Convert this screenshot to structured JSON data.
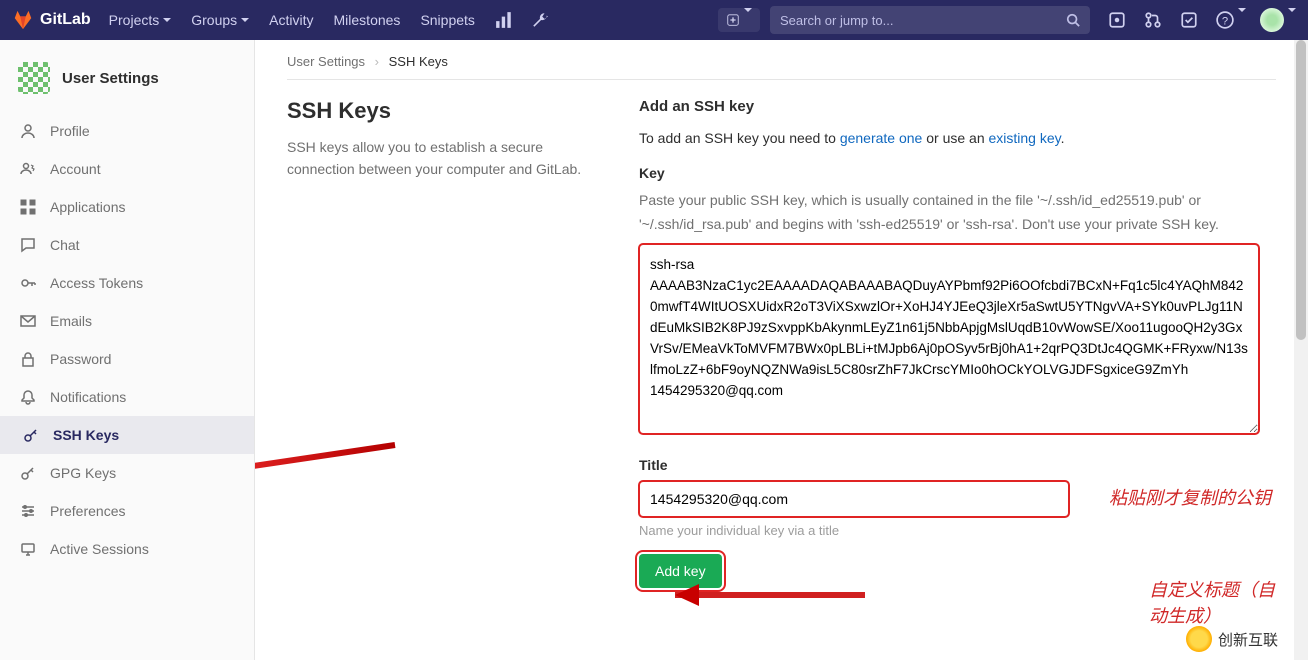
{
  "header": {
    "brand": "GitLab",
    "nav": {
      "projects": "Projects",
      "groups": "Groups",
      "activity": "Activity",
      "milestones": "Milestones",
      "snippets": "Snippets"
    },
    "search_placeholder": "Search or jump to..."
  },
  "sidebar": {
    "title": "User Settings",
    "items": [
      {
        "label": "Profile"
      },
      {
        "label": "Account"
      },
      {
        "label": "Applications"
      },
      {
        "label": "Chat"
      },
      {
        "label": "Access Tokens"
      },
      {
        "label": "Emails"
      },
      {
        "label": "Password"
      },
      {
        "label": "Notifications"
      },
      {
        "label": "SSH Keys"
      },
      {
        "label": "GPG Keys"
      },
      {
        "label": "Preferences"
      },
      {
        "label": "Active Sessions"
      }
    ]
  },
  "breadcrumb": {
    "root": "User Settings",
    "current": "SSH Keys"
  },
  "leftcol": {
    "title": "SSH Keys",
    "desc": "SSH keys allow you to establish a secure connection between your computer and GitLab."
  },
  "form": {
    "heading": "Add an SSH key",
    "intro_pre": "To add an SSH key you need to ",
    "link_generate": "generate one",
    "intro_mid": " or use an ",
    "link_existing": "existing key",
    "intro_post": ".",
    "key_label": "Key",
    "key_hint": "Paste your public SSH key, which is usually contained in the file '~/.ssh/id_ed25519.pub' or '~/.ssh/id_rsa.pub' and begins with 'ssh-ed25519' or 'ssh-rsa'. Don't use your private SSH key.",
    "key_value": "ssh-rsa AAAAB3NzaC1yc2EAAAADAQABAAABAQDuyAYPbmf92Pi6OOfcbdi7BCxN+Fq1c5lc4YAQhM8420mwfT4WItUOSXUidxR2oT3ViXSxwzlOr+XoHJ4YJEeQ3jleXr5aSwtU5YTNgvVA+SYk0uvPLJg11NdEuMkSIB2K8PJ9zSxvppKbAkynmLEyZ1n61j5NbbApjgMslUqdB10vWowSE/Xoo11ugooQH2y3GxVrSv/EMeaVkToMVFM7BWx0pLBLi+tMJpb6Aj0pOSyv5rBj0hA1+2qrPQ3DtJc4QGMK+FRyxw/N13slfmoLzZ+6bF9oyNQZNWa9isL5C80srZhF7JkCrscYMIo0hOCkYOLVGJDFSgxiceG9ZmYh 1454295320@qq.com",
    "title_label": "Title",
    "title_value": "1454295320@qq.com",
    "title_help": "Name your individual key via a title",
    "submit": "Add key"
  },
  "annotations": {
    "key": "粘贴刚才复制的公钥",
    "title": "自定义标题（自动生成）"
  },
  "watermark": "创新互联"
}
